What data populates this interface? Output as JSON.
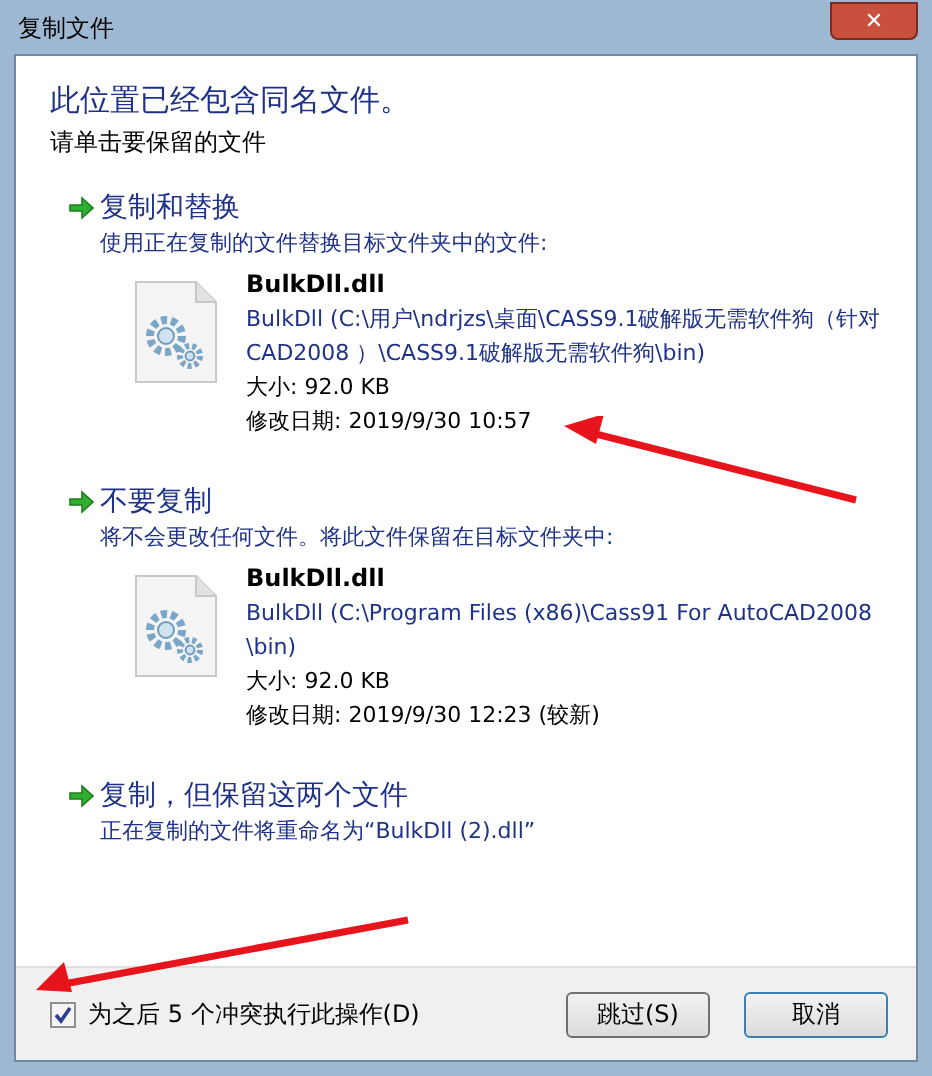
{
  "window": {
    "title": "复制文件",
    "close": "✕"
  },
  "heading": "此位置已经包含同名文件。",
  "subheading": "请单击要保留的文件",
  "options": [
    {
      "title": "复制和替换",
      "description": "使用正在复制的文件替换目标文件夹中的文件:",
      "file": {
        "name": "BulkDll.dll",
        "path": "BulkDll (C:\\用户\\ndrjzs\\桌面\\CASS9.1破解版无需软件狗（针对CAD2008 ）\\CASS9.1破解版无需软件狗\\bin)",
        "size": "大小: 92.0 KB",
        "modified": "修改日期: 2019/9/30 10:57"
      }
    },
    {
      "title": "不要复制",
      "description": "将不会更改任何文件。将此文件保留在目标文件夹中:",
      "file": {
        "name": "BulkDll.dll",
        "path": "BulkDll (C:\\Program Files (x86)\\Cass91 For AutoCAD2008\\bin)",
        "size": "大小: 92.0 KB",
        "modified": "修改日期: 2019/9/30 12:23 (较新)"
      }
    },
    {
      "title": "复制，但保留这两个文件",
      "description": "正在复制的文件将重命名为“BulkDll (2).dll”"
    }
  ],
  "checkbox": {
    "label": "为之后 5 个冲突执行此操作(D)",
    "checked": true
  },
  "buttons": [
    "跳过(S)",
    "取消"
  ]
}
